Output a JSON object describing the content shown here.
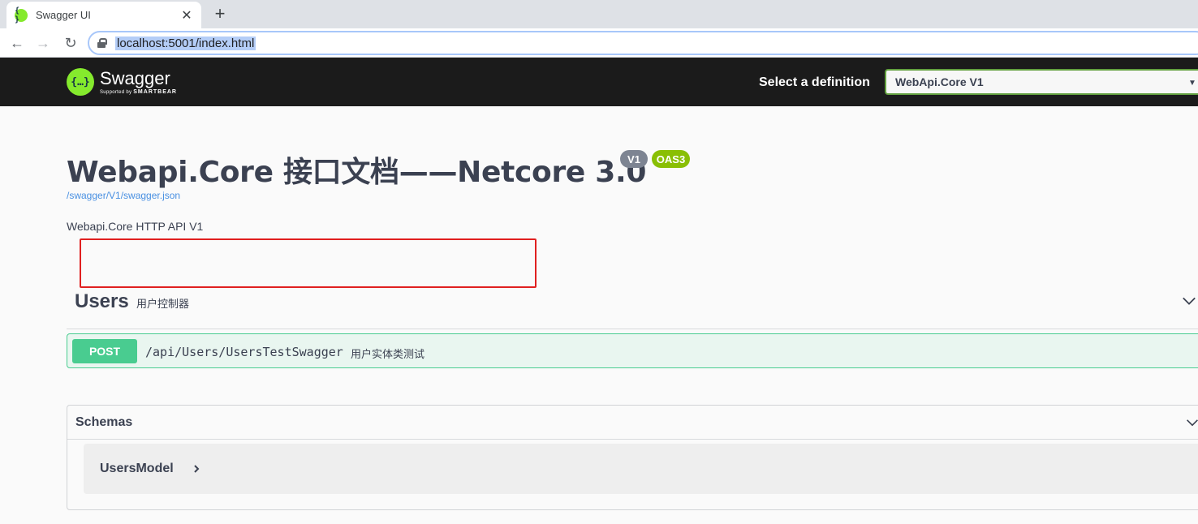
{
  "browser": {
    "tab_title": "Swagger UI",
    "tab_close": "✕",
    "new_tab": "+",
    "url": "localhost:5001/index.html",
    "nav": {
      "back": "←",
      "forward": "→",
      "reload": "↻"
    }
  },
  "topbar": {
    "logo_mark": "{…}",
    "logo_name": "Swagger",
    "logo_supported": "Supported by",
    "logo_brand": "SMARTBEAR",
    "definition_label": "Select a definition",
    "definition_value": "WebApi.Core V1"
  },
  "info": {
    "title": "Webapi.Core 接口文档——Netcore 3.0",
    "version_badge": "V1",
    "oas_badge": "OAS3",
    "spec_url": "/swagger/V1/swagger.json",
    "description": "Webapi.Core HTTP API V1"
  },
  "tags": [
    {
      "name": "Users",
      "description": "用户控制器",
      "operations": [
        {
          "method": "POST",
          "path": "/api/Users/UsersTestSwagger",
          "summary": "用户实体类测试"
        }
      ]
    }
  ],
  "schemas": {
    "title": "Schemas",
    "models": [
      {
        "name": "UsersModel"
      }
    ]
  },
  "colors": {
    "topbar_bg": "#1b1b1b",
    "post_green": "#49cc90",
    "post_bg": "#e9f6f0",
    "badge_gray": "#7d8492",
    "badge_green": "#89bf04",
    "annotation_red": "#e02020",
    "text": "#3b4151"
  },
  "icons": {
    "tab_favicon": "swagger-logo-icon",
    "lock": "lock-icon",
    "tag_toggle": "chevron-down-icon",
    "schemas_toggle": "chevron-down-icon",
    "model_expand": "chevron-right-icon"
  }
}
